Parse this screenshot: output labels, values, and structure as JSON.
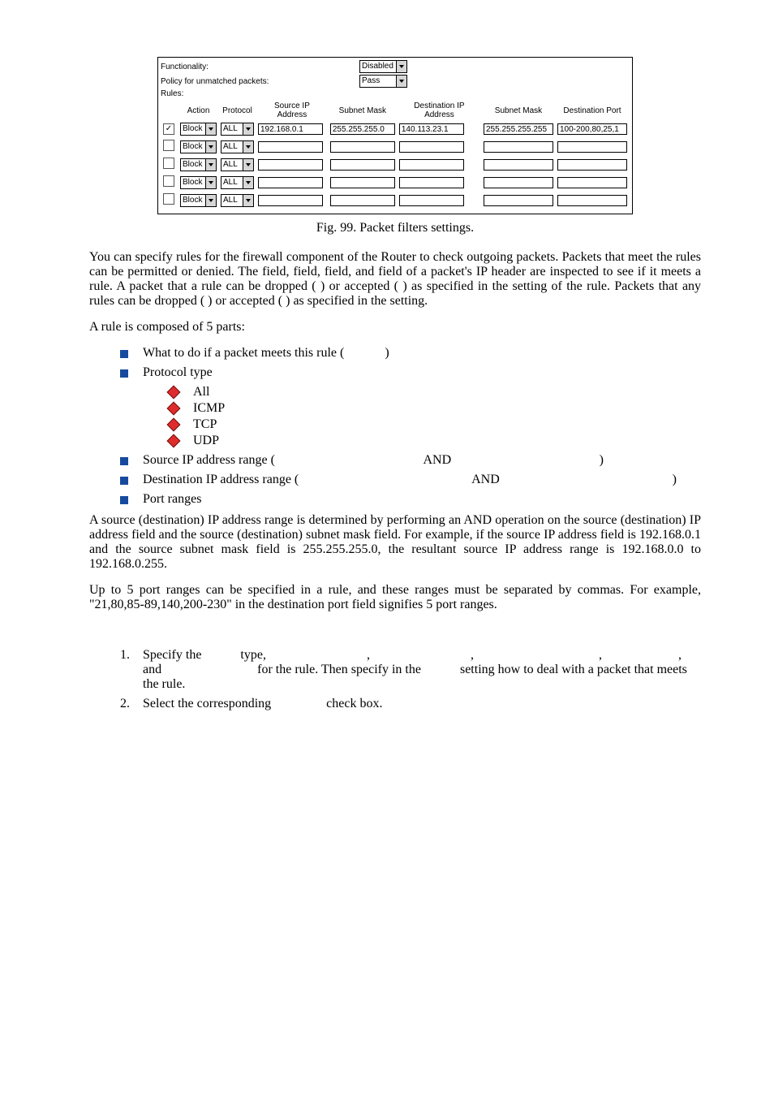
{
  "ui": {
    "functionality_label": "Functionality:",
    "functionality_value": "Disabled",
    "policy_label": "Policy for unmatched packets:",
    "policy_value": "Pass",
    "rules_label": "Rules:",
    "headers": {
      "action": "Action",
      "protocol": "Protocol",
      "source_ip": "Source IP Address",
      "subnet1": "Subnet Mask",
      "dest_ip": "Destination IP Address",
      "subnet2": "Subnet Mask",
      "dest_port": "Destination Port"
    },
    "row_defaults": {
      "action": "Block",
      "protocol": "ALL"
    },
    "rows": [
      {
        "checked": true,
        "source": "192.168.0.1",
        "subnet1": "255.255.255.0",
        "dest": "140.113.23.1",
        "subnet2": "255.255.255.255",
        "port": "100-200,80,25,1"
      },
      {
        "checked": false,
        "source": "",
        "subnet1": "",
        "dest": "",
        "subnet2": "",
        "port": ""
      },
      {
        "checked": false,
        "source": "",
        "subnet1": "",
        "dest": "",
        "subnet2": "",
        "port": ""
      },
      {
        "checked": false,
        "source": "",
        "subnet1": "",
        "dest": "",
        "subnet2": "",
        "port": ""
      },
      {
        "checked": false,
        "source": "",
        "subnet1": "",
        "dest": "",
        "subnet2": "",
        "port": ""
      }
    ]
  },
  "doc": {
    "caption": "Fig. 99. Packet filters settings.",
    "para1a": "You can specify rules for the firewall component of the Router to check outgoing packets. Packets that meet the rules can be permitted or denied. The ",
    "para1b": " field, ",
    "para1c": " field, ",
    "para1d": " field, and ",
    "para1e": " field of a packet's IP header are inspected to see if it meets a rule. A packet that ",
    "para1f": " a rule can be dropped (",
    "para1g": ") or accepted (",
    "para1h": ") as specified in the ",
    "para1i": " setting of the rule. Packets that ",
    "para1j": " any rules can be dropped (",
    "para1k": ") or accepted (",
    "para1l": ") as specified in the ",
    "para1m": " setting.",
    "para2": "A rule is composed of 5 parts:",
    "b1a": "What to do if a packet meets this rule (",
    "b1b": ")",
    "b2": "Protocol type",
    "pt_all": "All",
    "pt_icmp": "ICMP",
    "pt_tcp": "TCP",
    "pt_udp": "UDP",
    "b3a": "Source IP address range (",
    "b3and": "AND",
    "b3b": ")",
    "b4a": "Destination IP address range (",
    "b4and": "AND",
    "b4b": ")",
    "b5": "Port ranges",
    "para3": "A source (destination) IP address range is determined by performing an AND operation on the source (destination) IP address field and the source (destination) subnet mask field. For example, if the source IP address field is 192.168.0.1 and the source subnet mask field is 255.255.255.0, the resultant source IP address range is 192.168.0.0 to 192.168.0.255.",
    "para4": "Up to 5 port ranges can be specified in a rule, and these ranges must be separated by commas. For example, \"21,80,85-89,140,200-230\" in the destination port field signifies 5 port ranges.",
    "ol1_num": "1.",
    "ol1a": "Specify the ",
    "ol1b": " type, ",
    "ol1c": ", ",
    "ol1d": ", ",
    "ol1e": ", ",
    "ol1f": ", and ",
    "ol1g": " for the rule. Then specify in the ",
    "ol1h": " setting how to deal with a packet that meets the rule.",
    "ol2_num": "2.",
    "ol2a": "Select the corresponding ",
    "ol2b": " check box."
  }
}
